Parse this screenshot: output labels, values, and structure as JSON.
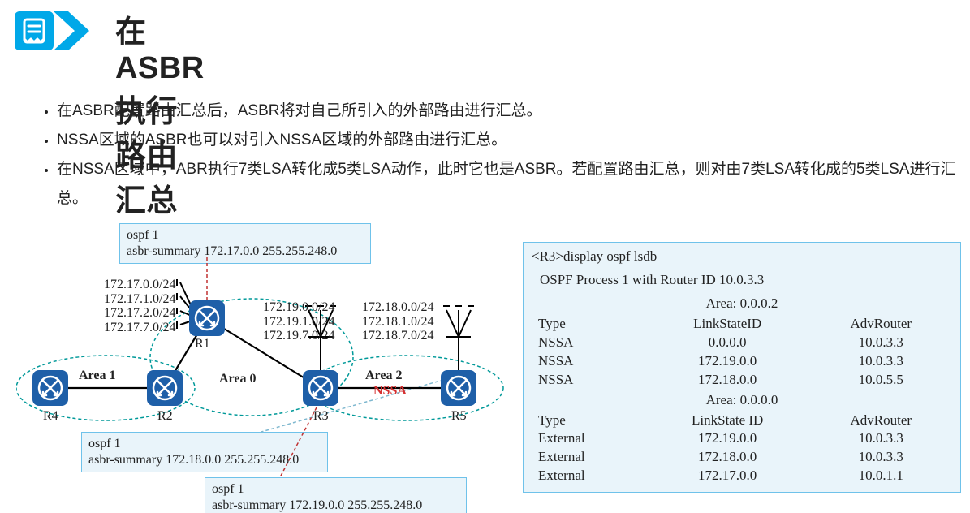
{
  "header": {
    "title": "在ASBR执行路由汇总"
  },
  "bullets": [
    "在ASBR配置路由汇总后，ASBR将对自己所引入的外部路由进行汇总。",
    "NSSA区域的ASBR也可以对引入NSSA区域的外部路由进行汇总。",
    "在NSSA区域中，ABR执行7类LSA转化成5类LSA动作，此时它也是ASBR。若配置路由汇总，则对由7类LSA转化成的5类LSA进行汇总。"
  ],
  "diagram": {
    "cfg_r1": {
      "line1": "ospf 1",
      "line2": "   asbr-summary 172.17.0.0 255.255.248.0"
    },
    "cfg_r5": {
      "line1": "ospf 1",
      "line2": "   asbr-summary 172.18.0.0 255.255.248.0"
    },
    "cfg_r3": {
      "line1": "ospf 1",
      "line2": "   asbr-summary 172.19.0.0 255.255.248.0"
    },
    "subnets_r1": "172.17.0.0/24\n172.17.1.0/24\n172.17.2.0/24\n172.17.7.0/24",
    "subnets_r3": "172.19.0.0/24\n172.19.1.0/24\n172.19.7.0/24",
    "subnets_r5": "172.18.0.0/24\n172.18.1.0/24\n172.18.7.0/24",
    "area1": "Area 1",
    "area0": "Area 0",
    "area2": "Area 2",
    "nssa": "NSSA",
    "routers": {
      "r1": "R1",
      "r2": "R2",
      "r3": "R3",
      "r4": "R4",
      "r5": "R5"
    }
  },
  "output": {
    "cmd": "<R3>display ospf lsdb",
    "process_line": "OSPF Process 1 with Router ID 10.0.3.3",
    "area02": "Area: 0.0.0.2",
    "hdr_type": "Type",
    "hdr_lsid": "LinkStateID",
    "hdr_lsid2": "LinkState ID",
    "hdr_adv": "AdvRouter",
    "rows02": [
      {
        "type": "NSSA",
        "lsid": "0.0.0.0",
        "adv": "10.0.3.3"
      },
      {
        "type": "NSSA",
        "lsid": "172.19.0.0",
        "adv": "10.0.3.3"
      },
      {
        "type": "NSSA",
        "lsid": "172.18.0.0",
        "adv": "10.0.5.5"
      }
    ],
    "area00": "Area: 0.0.0.0",
    "rows00": [
      {
        "type": "External",
        "lsid": "172.19.0.0",
        "adv": "10.0.3.3"
      },
      {
        "type": "External",
        "lsid": "172.18.0.0",
        "adv": "10.0.3.3"
      },
      {
        "type": "External",
        "lsid": "172.17.0.0",
        "adv": "10.0.1.1"
      }
    ]
  }
}
